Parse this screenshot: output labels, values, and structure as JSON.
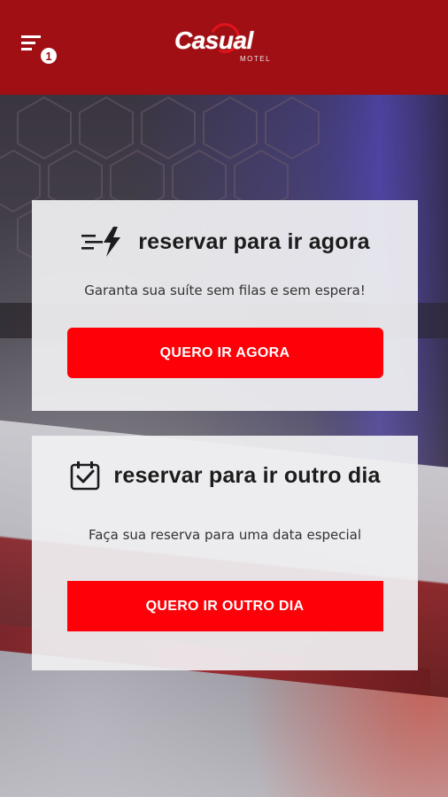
{
  "header": {
    "logo_text": "Casual",
    "logo_sub": "MOTEL",
    "menu_badge": "1",
    "brand_color": "#a00f14"
  },
  "cards": [
    {
      "icon": "fast-lightning-icon",
      "title": "reservar para ir agora",
      "subtitle": "Garanta sua suíte sem filas e sem espera!",
      "button_label": "QUERO IR AGORA"
    },
    {
      "icon": "calendar-check-icon",
      "title": "reservar para ir outro dia",
      "subtitle": "Faça sua reserva para uma data especial",
      "button_label": "QUERO IR OUTRO DIA"
    }
  ],
  "colors": {
    "accent": "#fd0008",
    "card_bg": "#f0f0f2"
  }
}
